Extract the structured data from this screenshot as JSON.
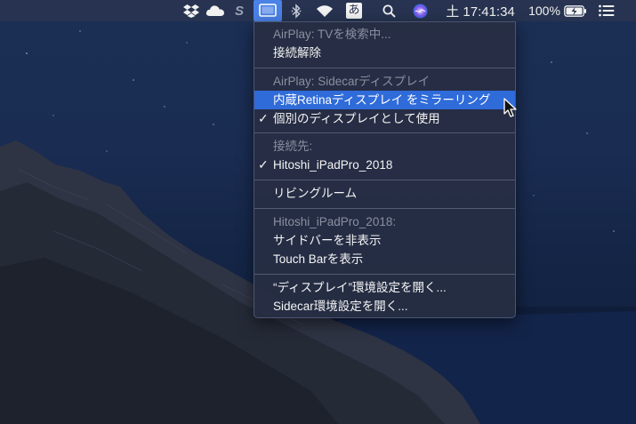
{
  "menubar": {
    "clock": "土 17:41:34",
    "battery_percent": "100%",
    "input_method": "あ"
  },
  "menu": {
    "groups": [
      {
        "items": [
          {
            "label": "AirPlay: TVを検索中...",
            "disabled": true
          },
          {
            "label": "接続解除",
            "disabled": false
          }
        ]
      },
      {
        "items": [
          {
            "label": "AirPlay: Sidecarディスプレイ",
            "disabled": true
          },
          {
            "label": "内蔵Retinaディスプレイ をミラーリング",
            "disabled": false,
            "highlighted": true
          },
          {
            "label": "個別のディスプレイとして使用",
            "disabled": false,
            "checked": true
          }
        ]
      },
      {
        "items": [
          {
            "label": "接続先:",
            "disabled": true
          },
          {
            "label": "Hitoshi_iPadPro_2018",
            "disabled": false,
            "checked": true
          }
        ]
      },
      {
        "items": [
          {
            "label": "リビングルーム",
            "disabled": false
          }
        ]
      },
      {
        "items": [
          {
            "label": "Hitoshi_iPadPro_2018:",
            "disabled": true
          },
          {
            "label": "サイドバーを非表示",
            "disabled": false
          },
          {
            "label": "Touch Barを表示",
            "disabled": false
          }
        ]
      },
      {
        "items": [
          {
            "label": "“ディスプレイ”環境設定を開く...",
            "disabled": false
          },
          {
            "label": "Sidecar環境設定を開く...",
            "disabled": false
          }
        ]
      }
    ],
    "check_glyph": "✓"
  },
  "colors": {
    "highlight": "#2f6bd9",
    "menu_bg": "#262e44",
    "disabled_text": "#8a90a0"
  },
  "icons": [
    "dropbox-icon",
    "icloud-icon",
    "s-app-icon",
    "airplay-display-icon",
    "bluetooth-icon",
    "wifi-icon",
    "input-method-icon",
    "search-icon",
    "siri-icon",
    "battery-icon",
    "control-list-icon"
  ]
}
